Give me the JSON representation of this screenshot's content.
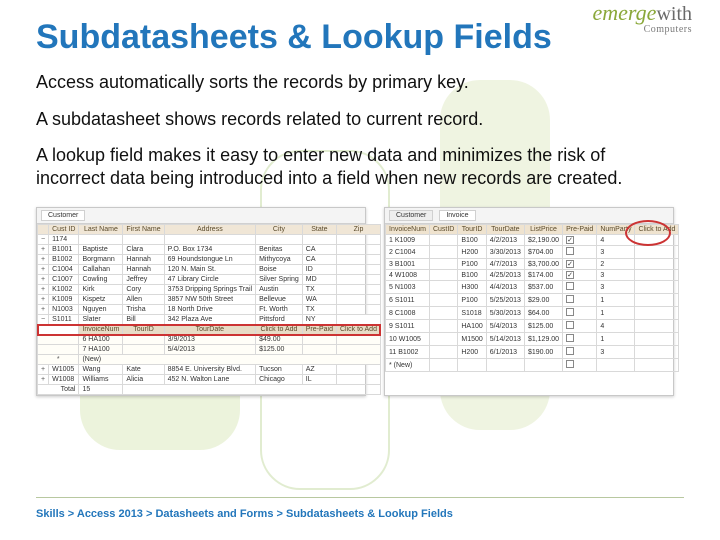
{
  "logo": {
    "brand_emph": "emerge",
    "brand_with": "with",
    "brand_sub": "Computers"
  },
  "title": "Subdatasheets & Lookup Fields",
  "paragraphs": {
    "p1": "Access automatically sorts the records by primary key.",
    "p2": "A subdatasheet shows records related to current record.",
    "p3": "A lookup field makes it easy to enter new data and minimizes the risk of incorrect data being introduced into a field when new records are created."
  },
  "left_tab": "Customer",
  "left_headers": [
    "",
    "Cust ID",
    "Last Name",
    "First Name",
    "Address",
    "City",
    "State",
    "Zip"
  ],
  "left_rows": [
    [
      "−",
      "1174",
      "",
      "",
      "",
      "",
      "",
      ""
    ],
    [
      "+",
      "B1001",
      "Baptiste",
      "Clara",
      "P.O. Box 1734",
      "Benitas",
      "CA",
      ""
    ],
    [
      "+",
      "B1002",
      "Borgmann",
      "Hannah",
      "69 Houndstongue Ln",
      "Mithycoya",
      "CA",
      ""
    ],
    [
      "+",
      "C1004",
      "Callahan",
      "Hannah",
      "120 N. Main St.",
      "Boise",
      "ID",
      ""
    ],
    [
      "+",
      "C1007",
      "Cowling",
      "Jeffrey",
      "47 Library Circle",
      "Silver Spring",
      "MD",
      ""
    ],
    [
      "+",
      "K1002",
      "Kirk",
      "Cory",
      "3753 Dripping Springs Trail",
      "Austin",
      "TX",
      ""
    ],
    [
      "+",
      "K1009",
      "Kispetz",
      "Allen",
      "3857 NW 50th Street",
      "Bellevue",
      "WA",
      ""
    ],
    [
      "+",
      "N1003",
      "Nguyen",
      "Trisha",
      "18 North Drive",
      "Ft. Worth",
      "TX",
      ""
    ],
    [
      "−",
      "S1011",
      "Slater",
      "Bill",
      "342 Plaza Ave",
      "Pittsford",
      "NY",
      ""
    ]
  ],
  "sub_headers": [
    "InvoiceNum",
    "TourID",
    "TourDate",
    "Click to Add",
    "Pre-Paid",
    "Click to Add"
  ],
  "sub_rows": [
    [
      "6 HA100",
      "",
      "3/9/2013",
      "$49.00",
      "",
      ""
    ],
    [
      "7 HA100",
      "",
      "5/4/2013",
      "$125.00",
      "",
      ""
    ]
  ],
  "left_newrow": "(New)",
  "left_tail": [
    [
      "+",
      "W1005",
      "Wang",
      "Kate",
      "8854 E. University Blvd.",
      "Tucson",
      "AZ",
      ""
    ],
    [
      "+",
      "W1008",
      "Williams",
      "Alicia",
      "452 N. Walton Lane",
      "Chicago",
      "IL",
      ""
    ]
  ],
  "left_footer_label": "Total",
  "left_footer_value": "15",
  "right_tabs": [
    "Customer",
    "Invoice"
  ],
  "right_headers": [
    "InvoiceNum",
    "CustID",
    "TourID",
    "TourDate",
    "ListPrice",
    "Pre-Paid",
    "NumParty",
    "Click to Add"
  ],
  "right_rows": [
    [
      "1 K1009",
      "",
      "B100",
      "4/2/2013",
      "$2,190.00",
      "☑",
      "4",
      ""
    ],
    [
      "2 C1004",
      "",
      "H200",
      "3/30/2013",
      "$704.00",
      "☐",
      "3",
      ""
    ],
    [
      "3 B1001",
      "",
      "P100",
      "4/7/2013",
      "$3,700.00",
      "☑",
      "2",
      ""
    ],
    [
      "4 W1008",
      "",
      "B100",
      "4/25/2013",
      "$174.00",
      "☑",
      "3",
      ""
    ],
    [
      "5 N1003",
      "",
      "H300",
      "4/4/2013",
      "$537.00",
      "☐",
      "3",
      ""
    ],
    [
      "6 S1011",
      "",
      "P100",
      "5/25/2013",
      "$29.00",
      "☐",
      "1",
      ""
    ],
    [
      "8 C1008",
      "",
      "S1018",
      "5/30/2013",
      "$64.00",
      "☐",
      "1",
      ""
    ],
    [
      "9 S1011",
      "",
      "HA100",
      "5/4/2013",
      "$125.00",
      "☐",
      "4",
      ""
    ],
    [
      "10 W1005",
      "",
      "M1500",
      "5/14/2013",
      "$1,129.00",
      "☐",
      "1",
      ""
    ],
    [
      "11 B1002",
      "",
      "H200",
      "6/1/2013",
      "$190.00",
      "☐",
      "3",
      ""
    ]
  ],
  "right_newrow": "(New)",
  "breadcrumbs": "Skills > Access 2013 > Datasheets and Forms > Subdatasheets & Lookup Fields"
}
